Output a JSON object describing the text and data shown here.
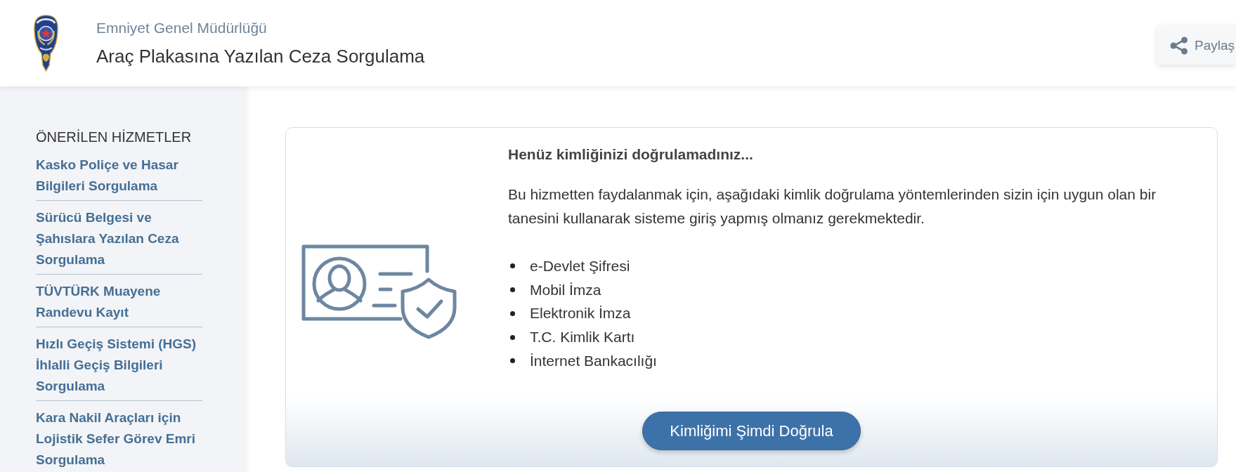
{
  "header": {
    "organization": "Emniyet Genel Müdürlüğü",
    "title": "Araç Plakasına Yazılan Ceza Sorgulama",
    "share_button": "Paylaş"
  },
  "sidebar": {
    "heading": "ÖNERİLEN HİZMETLER",
    "items": [
      "Kasko Poliçe ve Hasar Bilgileri Sorgulama",
      "Sürücü Belgesi ve Şahıslara Yazılan Ceza Sorgulama",
      "TÜVTÜRK Muayene Randevu Kayıt",
      "Hızlı Geçiş Sistemi (HGS) İhlalli Geçiş Bilgileri Sorgulama",
      "Kara Nakil Araçları için Lojistik Sefer Görev Emri Sorgulama"
    ]
  },
  "verification_card": {
    "heading": "Henüz kimliğinizi doğrulamadınız...",
    "description": "Bu hizmetten faydalanmak için, aşağıdaki kimlik doğrulama yöntemlerinden sizin için uygun olan bir tanesini kullanarak sisteme giriş yapmış olmanız gerekmektedir.",
    "methods": [
      "e-Devlet Şifresi",
      "Mobil İmza",
      "Elektronik İmza",
      "T.C. Kimlik Kartı",
      "İnternet Bankacılığı"
    ],
    "button": "Kimliğimi Şimdi Doğrula"
  }
}
